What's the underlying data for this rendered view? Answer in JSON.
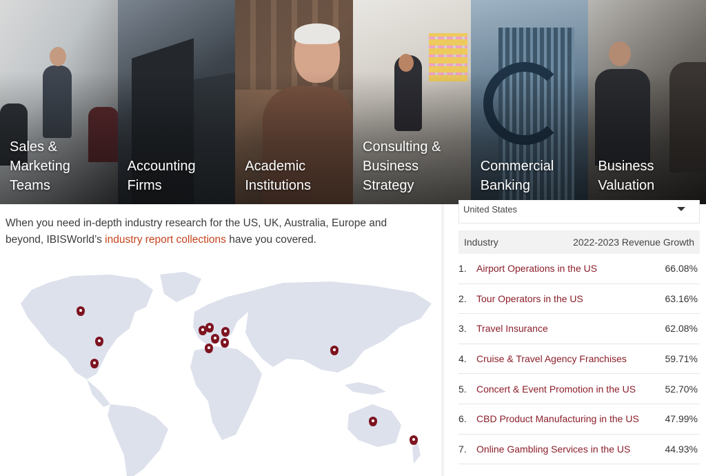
{
  "tiles": [
    {
      "label": "Sales &\nMarketing\nTeams"
    },
    {
      "label": "Accounting\nFirms"
    },
    {
      "label": "Academic\nInstitutions"
    },
    {
      "label": "Consulting &\nBusiness\nStrategy"
    },
    {
      "label": "Commercial\nBanking"
    },
    {
      "label": "Business\nValuation"
    }
  ],
  "intro": {
    "text_before": "When you need in-depth industry research for the US, UK, Australia, Europe and beyond, IBISWorld’s ",
    "link": "industry report collections",
    "text_after": " have you covered."
  },
  "country_select": {
    "value": "United States"
  },
  "table": {
    "col_industry": "Industry",
    "col_growth": "2022-2023 Revenue Growth",
    "rows": [
      {
        "rank": "1.",
        "name": "Airport Operations in the US",
        "value": "66.08%"
      },
      {
        "rank": "2.",
        "name": "Tour Operators in the US",
        "value": "63.16%"
      },
      {
        "rank": "3.",
        "name": "Travel Insurance",
        "value": "62.08%"
      },
      {
        "rank": "4.",
        "name": "Cruise & Travel Agency Franchises",
        "value": "59.71%"
      },
      {
        "rank": "5.",
        "name": "Concert & Event Promotion in the US",
        "value": "52.70%"
      },
      {
        "rank": "6.",
        "name": "CBD Product Manufacturing in the US",
        "value": "47.99%"
      },
      {
        "rank": "7.",
        "name": "Online Gambling Services in the US",
        "value": "44.93%"
      }
    ]
  },
  "colors": {
    "accent_link": "#c4431c",
    "industry_link": "#8b1e2a",
    "map_land": "#dde1ec",
    "pin": "#7d1420"
  }
}
